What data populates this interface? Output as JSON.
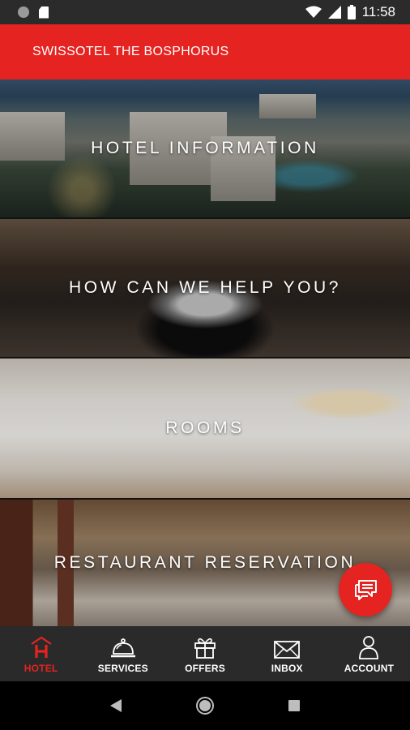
{
  "status_bar": {
    "time": "11:58",
    "icons": [
      "notification-dot-icon",
      "sd-card-icon",
      "wifi-icon",
      "signal-icon",
      "battery-icon"
    ]
  },
  "header": {
    "title": "SWISSOTEL THE BOSPHORUS",
    "color": "#e52421"
  },
  "tiles": [
    {
      "label": "HOTEL INFORMATION"
    },
    {
      "label": "HOW CAN WE HELP YOU?"
    },
    {
      "label": "ROOMS"
    },
    {
      "label": "RESTAURANT RESERVATION"
    }
  ],
  "chat_button": {
    "icon": "chat-bubbles-icon"
  },
  "bottom_nav": {
    "active_color": "#e52421",
    "items": [
      {
        "label": "HOTEL",
        "icon": "hotel-icon",
        "active": true
      },
      {
        "label": "SERVICES",
        "icon": "service-bell-icon",
        "active": false
      },
      {
        "label": "OFFERS",
        "icon": "gift-icon",
        "active": false
      },
      {
        "label": "INBOX",
        "icon": "envelope-icon",
        "active": false
      },
      {
        "label": "ACCOUNT",
        "icon": "person-icon",
        "active": false
      }
    ]
  },
  "system_nav": {
    "icons": [
      "back-icon",
      "home-icon",
      "recents-icon"
    ]
  }
}
